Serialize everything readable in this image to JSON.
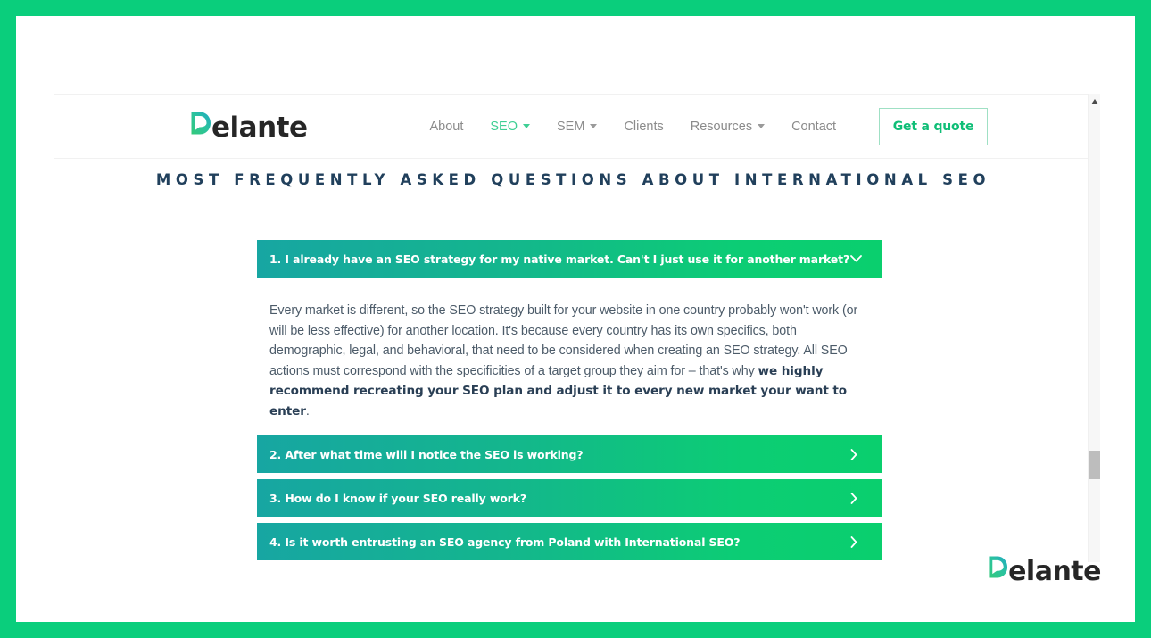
{
  "theme": {
    "frame_color": "#0ace7c",
    "accent_green": "#0acf6e",
    "accent_teal": "#17a6a2",
    "heading_navy": "#21405c",
    "body_text": "#4c5b69",
    "nav_gray": "#8b8b8b",
    "nav_active": "#3ecf94"
  },
  "header": {
    "logo": {
      "mark": "speech-bubble-d",
      "word": "elante",
      "full": "Delante"
    },
    "nav": [
      {
        "label": "About",
        "has_dropdown": false,
        "active": false
      },
      {
        "label": "SEO",
        "has_dropdown": true,
        "active": true
      },
      {
        "label": "SEM",
        "has_dropdown": true,
        "active": false
      },
      {
        "label": "Clients",
        "has_dropdown": false,
        "active": false
      },
      {
        "label": "Resources",
        "has_dropdown": true,
        "active": false
      },
      {
        "label": "Contact",
        "has_dropdown": false,
        "active": false
      }
    ],
    "cta_label": "Get a quote"
  },
  "section": {
    "heading": "MOST FREQUENTLY ASKED QUESTIONS ABOUT INTERNATIONAL SEO"
  },
  "faq": {
    "items": [
      {
        "title": "1. I already have an SEO strategy for my native market. Can't I just use it for another market?",
        "expanded": true,
        "toggle_icon": "chevron-down-icon",
        "body_lead": "Every market is different, so the SEO strategy built for your website in one country probably won't work (or will be less effective) for another location. It's because every country has its own specifics, both demographic, legal, and behavioral, that need to be considered when creating an SEO strategy. All SEO actions must correspond with the specificities of a target group they aim for – that's why ",
        "body_bold": "we highly recommend recreating your SEO plan and adjust it to every new market your want to enter",
        "body_tail": "."
      },
      {
        "title": "2. After what time will I notice the SEO is working?",
        "expanded": false,
        "toggle_icon": "chevron-right-icon"
      },
      {
        "title": "3. How do I know if your SEO really work?",
        "expanded": false,
        "toggle_icon": "chevron-right-icon"
      },
      {
        "title": "4. Is it worth entrusting an SEO agency from Poland with International SEO?",
        "expanded": false,
        "toggle_icon": "chevron-right-icon"
      }
    ]
  },
  "footer": {
    "logo": {
      "mark": "speech-bubble-d",
      "word": "elante",
      "full": "Delante"
    }
  },
  "scrollbar": {
    "up_arrow_icon": "triangle-up-icon",
    "thumb_position_pct": 76
  }
}
